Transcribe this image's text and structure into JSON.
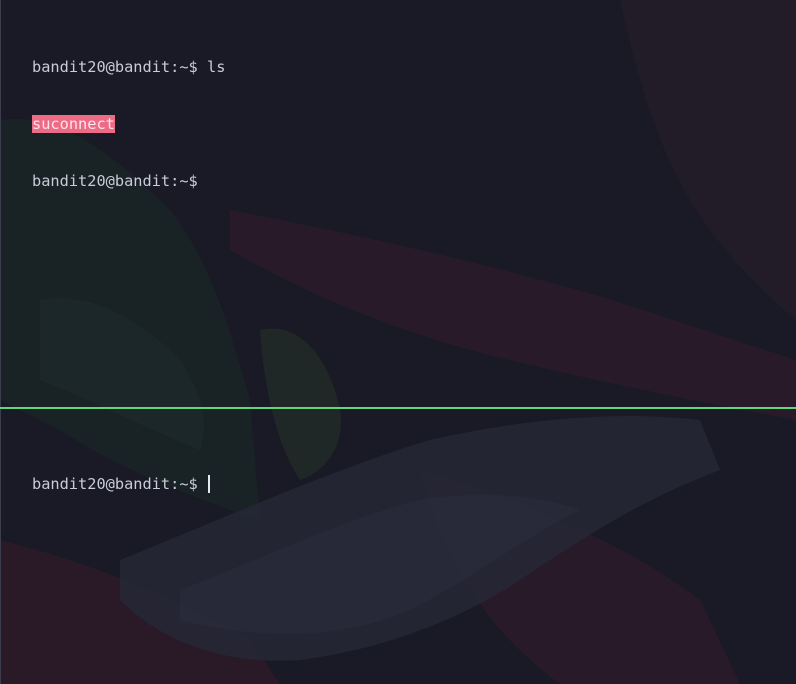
{
  "terminal": {
    "top_pane": {
      "prompt": "bandit20@bandit:~$",
      "command": "ls",
      "output_file": "suconnect",
      "prompt_2": "bandit20@bandit:~$"
    },
    "bottom_pane": {
      "prompt": "bandit20@bandit:~$"
    },
    "colors": {
      "background": "#1d1e2a",
      "text": "#c9cbd8",
      "executable_highlight": "#ee6b86",
      "active_pane_border": "#5fd67a"
    }
  }
}
